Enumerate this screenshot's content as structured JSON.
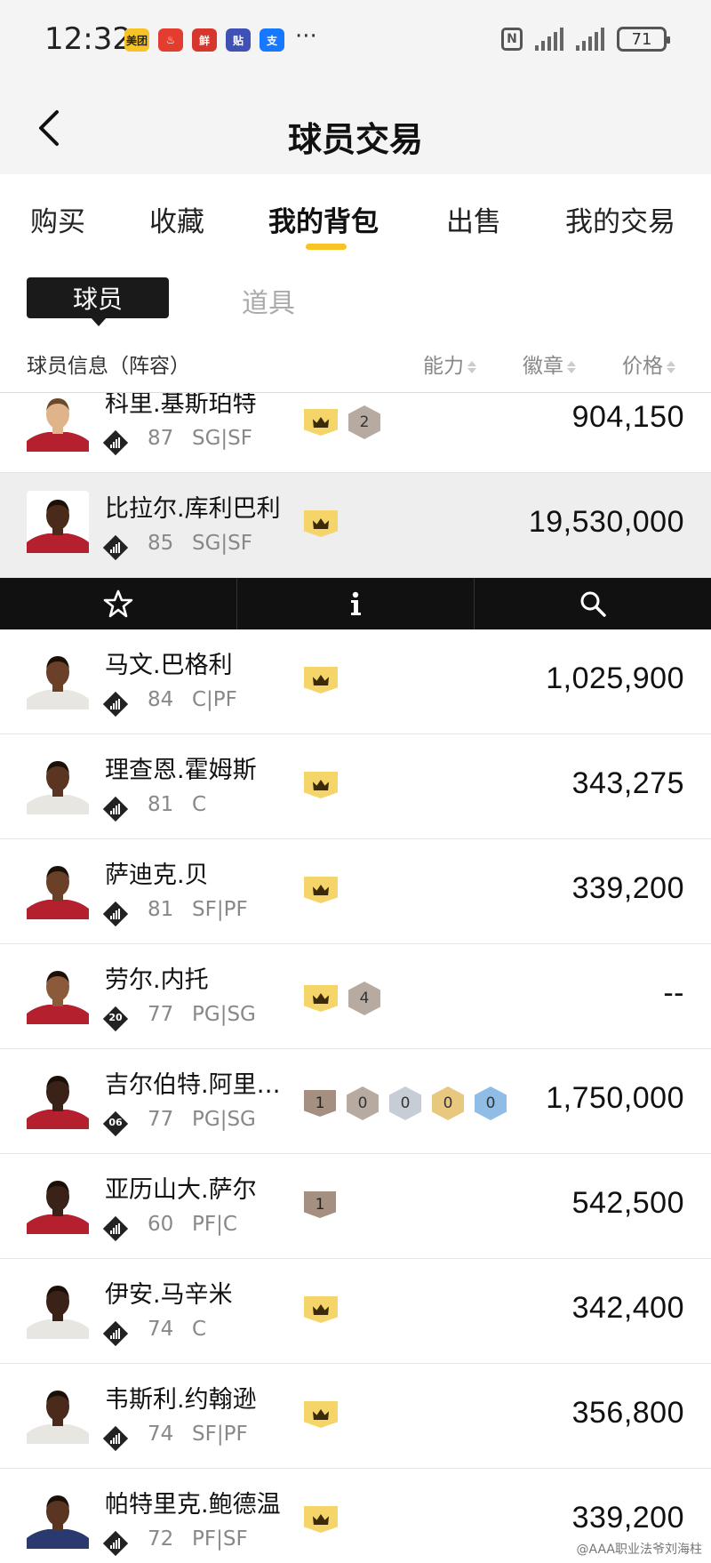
{
  "status_bar": {
    "time": "12:32",
    "apps": [
      {
        "label": "美团",
        "color": "#f7c325",
        "text_color": "#222"
      },
      {
        "label": "♨",
        "color": "#e33d2f",
        "text_color": "#fff"
      },
      {
        "label": "鲜",
        "color": "#d6362c",
        "text_color": "#fff"
      },
      {
        "label": "贴",
        "color": "#3f51b5",
        "text_color": "#fff"
      },
      {
        "label": "支",
        "color": "#1677ff",
        "text_color": "#fff"
      }
    ],
    "more": "···",
    "nfc": "N",
    "battery": "71"
  },
  "nav": {
    "title": "球员交易"
  },
  "top_tabs": [
    {
      "label": "购买",
      "active": false
    },
    {
      "label": "收藏",
      "active": false
    },
    {
      "label": "我的背包",
      "active": true
    },
    {
      "label": "出售",
      "active": false
    },
    {
      "label": "我的交易",
      "active": false
    }
  ],
  "sub_tabs": {
    "active": "球员",
    "other": "道具"
  },
  "columns": {
    "info": "球员信息（阵容）",
    "ability": "能力",
    "badge": "徽章",
    "price": "价格"
  },
  "players": [
    {
      "name": "科里.基斯珀特",
      "rating": "87",
      "pos": "SG|SF",
      "rank": "",
      "badges": [
        {
          "type": "crown"
        },
        {
          "type": "gray",
          "text": "2"
        }
      ],
      "price": "904,150",
      "skin": "#e0b48a",
      "jersey": "#b5202e",
      "hair": "#6b4a2a"
    },
    {
      "name": "比拉尔.库利巴利",
      "rating": "85",
      "pos": "SG|SF",
      "rank": "",
      "badges": [
        {
          "type": "crown"
        }
      ],
      "price": "19,530,000",
      "skin": "#4a2a1a",
      "jersey": "#b5202e",
      "hair": "#1a1008"
    },
    {
      "name": "马文.巴格利",
      "rating": "84",
      "pos": "C|PF",
      "rank": "",
      "badges": [
        {
          "type": "crown"
        }
      ],
      "price": "1,025,900",
      "skin": "#6a4028",
      "jersey": "#e8e6e0",
      "hair": "#1a1008"
    },
    {
      "name": "理查恩.霍姆斯",
      "rating": "81",
      "pos": "C",
      "rank": "",
      "badges": [
        {
          "type": "crown"
        }
      ],
      "price": "343,275",
      "skin": "#5a3522",
      "jersey": "#e8e6e0",
      "hair": "#1a1008"
    },
    {
      "name": "萨迪克.贝",
      "rating": "81",
      "pos": "SF|PF",
      "rank": "",
      "badges": [
        {
          "type": "crown"
        }
      ],
      "price": "339,200",
      "skin": "#6a4028",
      "jersey": "#b5202e",
      "hair": "#1a1008"
    },
    {
      "name": "劳尔.内托",
      "rating": "77",
      "pos": "PG|SG",
      "rank": "20",
      "badges": [
        {
          "type": "crown"
        },
        {
          "type": "gray",
          "text": "4"
        }
      ],
      "price": "--",
      "skin": "#8a5a3a",
      "jersey": "#b5202e",
      "hair": "#1a1008"
    },
    {
      "name": "吉尔伯特.阿里…",
      "rating": "77",
      "pos": "PG|SG",
      "rank": "06",
      "badges": [
        {
          "type": "brown",
          "text": "1"
        },
        {
          "type": "gray",
          "text": "0"
        },
        {
          "type": "silver",
          "text": "0"
        },
        {
          "type": "gold",
          "text": "0"
        },
        {
          "type": "blue",
          "text": "0"
        }
      ],
      "price": "1,750,000",
      "skin": "#3a2218",
      "jersey": "#b5202e",
      "hair": "#1a1008"
    },
    {
      "name": "亚历山大.萨尔",
      "rating": "60",
      "pos": "PF|C",
      "rank": "",
      "badges": [
        {
          "type": "brown",
          "text": "1"
        }
      ],
      "price": "542,500",
      "skin": "#3a2218",
      "jersey": "#b5202e",
      "hair": "#1a1008"
    },
    {
      "name": "伊安.马辛米",
      "rating": "74",
      "pos": "C",
      "rank": "",
      "badges": [
        {
          "type": "crown"
        }
      ],
      "price": "342,400",
      "skin": "#3a2218",
      "jersey": "#e8e6e0",
      "hair": "#1a1008"
    },
    {
      "name": "韦斯利.约翰逊",
      "rating": "74",
      "pos": "SF|PF",
      "rank": "",
      "badges": [
        {
          "type": "crown"
        }
      ],
      "price": "356,800",
      "skin": "#4a2a1a",
      "jersey": "#e8e6e0",
      "hair": "#1a1008"
    },
    {
      "name": "帕特里克.鲍德温",
      "rating": "72",
      "pos": "PF|SF",
      "rank": "",
      "badges": [
        {
          "type": "crown"
        }
      ],
      "price": "339,200",
      "skin": "#5a3522",
      "jersey": "#2a3a70",
      "hair": "#1a1008"
    }
  ],
  "selected_index": 1,
  "action_bar": [
    "star-icon",
    "info-icon",
    "search-icon"
  ],
  "watermark": "@AAA职业法爷刘海柱"
}
